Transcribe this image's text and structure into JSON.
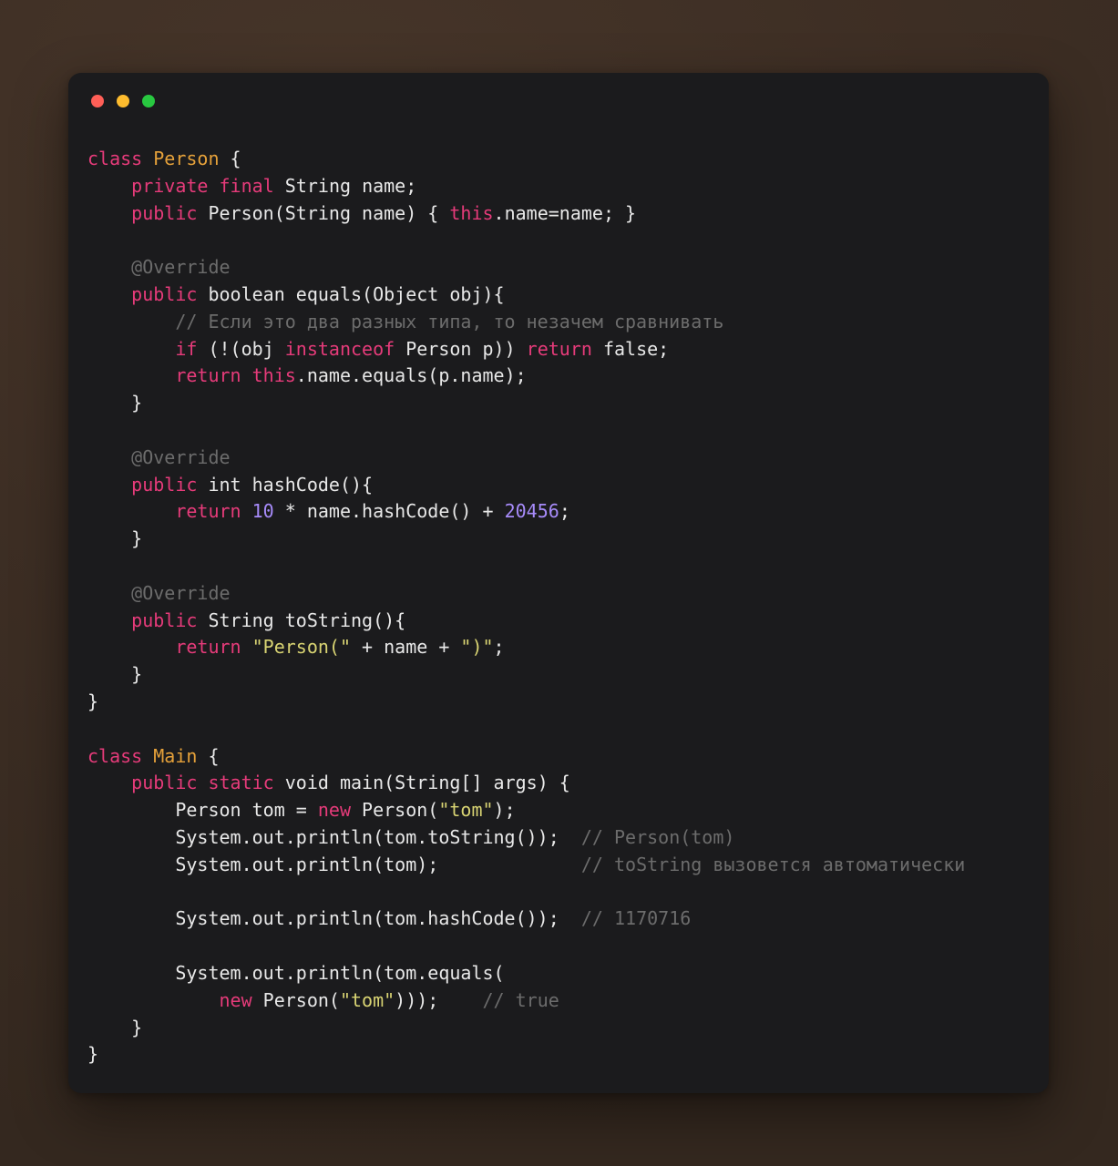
{
  "window": {
    "traffic_lights": [
      {
        "name": "close",
        "color": "#ff5f57"
      },
      {
        "name": "minimize",
        "color": "#febc2e"
      },
      {
        "name": "maximize",
        "color": "#28c840"
      }
    ],
    "background_color": "#3d2e24",
    "panel_color": "#1b1b1d"
  },
  "theme": {
    "keyword": "#e63b7a",
    "class_name": "#e5a13a",
    "string": "#d9d473",
    "number": "#a78bfa",
    "comment": "#6c6c6c",
    "plain": "#e8e8e8"
  },
  "code": {
    "language": "java",
    "lines": [
      [
        {
          "t": "class",
          "c": "kw"
        },
        {
          "t": " ",
          "c": "pln"
        },
        {
          "t": "Person",
          "c": "cls"
        },
        {
          "t": " {",
          "c": "pln"
        }
      ],
      [
        {
          "t": "    ",
          "c": "pln"
        },
        {
          "t": "private",
          "c": "kw"
        },
        {
          "t": " ",
          "c": "pln"
        },
        {
          "t": "final",
          "c": "kw"
        },
        {
          "t": " String name;",
          "c": "pln"
        }
      ],
      [
        {
          "t": "    ",
          "c": "pln"
        },
        {
          "t": "public",
          "c": "kw"
        },
        {
          "t": " Person(String name) { ",
          "c": "pln"
        },
        {
          "t": "this",
          "c": "kw"
        },
        {
          "t": ".name=name; }",
          "c": "pln"
        }
      ],
      [],
      [
        {
          "t": "    ",
          "c": "pln"
        },
        {
          "t": "@Override",
          "c": "cmt"
        }
      ],
      [
        {
          "t": "    ",
          "c": "pln"
        },
        {
          "t": "public",
          "c": "kw"
        },
        {
          "t": " boolean equals(Object obj){",
          "c": "pln"
        }
      ],
      [
        {
          "t": "        ",
          "c": "pln"
        },
        {
          "t": "// Если это два разных типа, то незачем сравнивать",
          "c": "cmt"
        }
      ],
      [
        {
          "t": "        ",
          "c": "pln"
        },
        {
          "t": "if",
          "c": "kw"
        },
        {
          "t": " (!(obj ",
          "c": "pln"
        },
        {
          "t": "instanceof",
          "c": "kw"
        },
        {
          "t": " Person p)) ",
          "c": "pln"
        },
        {
          "t": "return",
          "c": "kw"
        },
        {
          "t": " false;",
          "c": "pln"
        }
      ],
      [
        {
          "t": "        ",
          "c": "pln"
        },
        {
          "t": "return",
          "c": "kw"
        },
        {
          "t": " ",
          "c": "pln"
        },
        {
          "t": "this",
          "c": "kw"
        },
        {
          "t": ".name.equals(p.name);",
          "c": "pln"
        }
      ],
      [
        {
          "t": "    }",
          "c": "pln"
        }
      ],
      [],
      [
        {
          "t": "    ",
          "c": "pln"
        },
        {
          "t": "@Override",
          "c": "cmt"
        }
      ],
      [
        {
          "t": "    ",
          "c": "pln"
        },
        {
          "t": "public",
          "c": "kw"
        },
        {
          "t": " int hashCode(){",
          "c": "pln"
        }
      ],
      [
        {
          "t": "        ",
          "c": "pln"
        },
        {
          "t": "return",
          "c": "kw"
        },
        {
          "t": " ",
          "c": "pln"
        },
        {
          "t": "10",
          "c": "num"
        },
        {
          "t": " * name.hashCode() + ",
          "c": "pln"
        },
        {
          "t": "20456",
          "c": "num"
        },
        {
          "t": ";",
          "c": "pln"
        }
      ],
      [
        {
          "t": "    }",
          "c": "pln"
        }
      ],
      [],
      [
        {
          "t": "    ",
          "c": "pln"
        },
        {
          "t": "@Override",
          "c": "cmt"
        }
      ],
      [
        {
          "t": "    ",
          "c": "pln"
        },
        {
          "t": "public",
          "c": "kw"
        },
        {
          "t": " String toString(){",
          "c": "pln"
        }
      ],
      [
        {
          "t": "        ",
          "c": "pln"
        },
        {
          "t": "return",
          "c": "kw"
        },
        {
          "t": " ",
          "c": "pln"
        },
        {
          "t": "\"Person(\"",
          "c": "str"
        },
        {
          "t": " + name + ",
          "c": "pln"
        },
        {
          "t": "\")\"",
          "c": "str"
        },
        {
          "t": ";",
          "c": "pln"
        }
      ],
      [
        {
          "t": "    }",
          "c": "pln"
        }
      ],
      [
        {
          "t": "}",
          "c": "pln"
        }
      ],
      [],
      [
        {
          "t": "class",
          "c": "kw"
        },
        {
          "t": " ",
          "c": "pln"
        },
        {
          "t": "Main",
          "c": "cls"
        },
        {
          "t": " {",
          "c": "pln"
        }
      ],
      [
        {
          "t": "    ",
          "c": "pln"
        },
        {
          "t": "public",
          "c": "kw"
        },
        {
          "t": " ",
          "c": "pln"
        },
        {
          "t": "static",
          "c": "kw"
        },
        {
          "t": " void main(String[] args) {",
          "c": "pln"
        }
      ],
      [
        {
          "t": "        Person tom = ",
          "c": "pln"
        },
        {
          "t": "new",
          "c": "kw"
        },
        {
          "t": " Person(",
          "c": "pln"
        },
        {
          "t": "\"tom\"",
          "c": "str"
        },
        {
          "t": ");",
          "c": "pln"
        }
      ],
      [
        {
          "t": "        System.out.println(tom.toString());  ",
          "c": "pln"
        },
        {
          "t": "// Person(tom)",
          "c": "cmt"
        }
      ],
      [
        {
          "t": "        System.out.println(tom);             ",
          "c": "pln"
        },
        {
          "t": "// toString вызовется автоматически",
          "c": "cmt"
        }
      ],
      [],
      [
        {
          "t": "        System.out.println(tom.hashCode());  ",
          "c": "pln"
        },
        {
          "t": "// 1170716",
          "c": "cmt"
        }
      ],
      [],
      [
        {
          "t": "        System.out.println(tom.equals(",
          "c": "pln"
        }
      ],
      [
        {
          "t": "            ",
          "c": "pln"
        },
        {
          "t": "new",
          "c": "kw"
        },
        {
          "t": " Person(",
          "c": "pln"
        },
        {
          "t": "\"tom\"",
          "c": "str"
        },
        {
          "t": ")));    ",
          "c": "pln"
        },
        {
          "t": "// true",
          "c": "cmt"
        }
      ],
      [
        {
          "t": "    }",
          "c": "pln"
        }
      ],
      [
        {
          "t": "}",
          "c": "pln"
        }
      ]
    ]
  }
}
